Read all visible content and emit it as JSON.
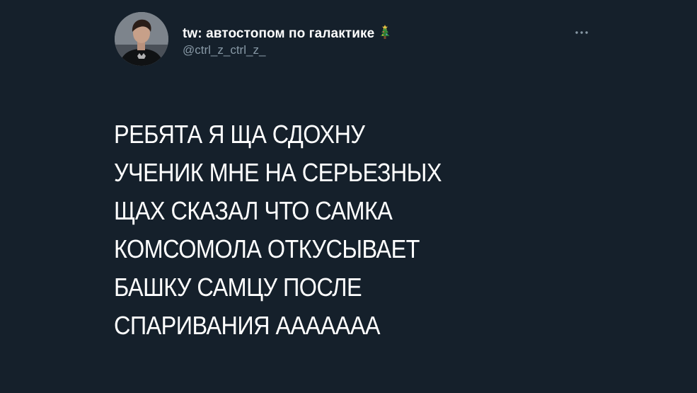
{
  "tweet": {
    "display_name": "tw: автостопом по галактике",
    "name_emoji": "christmas-tree-icon",
    "handle": "@ctrl_z_ctrl_z_",
    "more_icon": "more-horizontal-icon",
    "text_lines": [
      "РЕБЯТА Я ЩА СДОХНУ",
      "УЧЕНИК МНЕ НА СЕРЬЕЗНЫХ",
      "ЩАХ СКАЗАЛ ЧТО САМКА",
      "КОМСОМОЛА ОТКУСЫВАЕТ",
      "БАШКУ САМЦУ ПОСЛЕ",
      "СПАРИВАНИЯ ААААААА"
    ]
  },
  "colors": {
    "background": "#15202b",
    "text": "#ffffff",
    "secondary_text": "#8899a6"
  }
}
